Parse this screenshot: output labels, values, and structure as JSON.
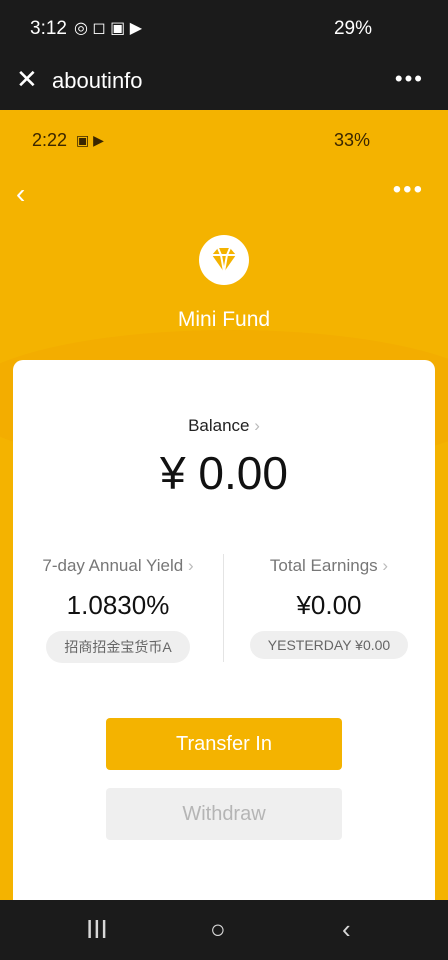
{
  "status_bar": {
    "time": "3:12",
    "signal": "LTE+",
    "battery": "29%"
  },
  "title_bar": {
    "title": "aboutinfo",
    "more": "⋮"
  },
  "inner_status": {
    "time": "2:22",
    "signal": "LTE+",
    "battery": "33%"
  },
  "nav": {
    "back": "‹",
    "more": "⋮"
  },
  "fund": {
    "name": "Mini Fund"
  },
  "balance": {
    "label": "Balance",
    "chevron": "›",
    "value": "¥ 0.00"
  },
  "yield": {
    "label": "7-day Annual Yield",
    "value": "1.0830%",
    "pill": "招商招金宝货币A"
  },
  "earnings": {
    "label": "Total Earnings",
    "value": "¥0.00",
    "pill": "YESTERDAY  ¥0.00"
  },
  "buttons": {
    "transfer_in": "Transfer In",
    "withdraw": "Withdraw"
  },
  "bottom_nav": {
    "recent": "III",
    "home": "○",
    "back": "‹"
  },
  "colors": {
    "accent": "#f4b300",
    "disabled": "#efefef"
  }
}
